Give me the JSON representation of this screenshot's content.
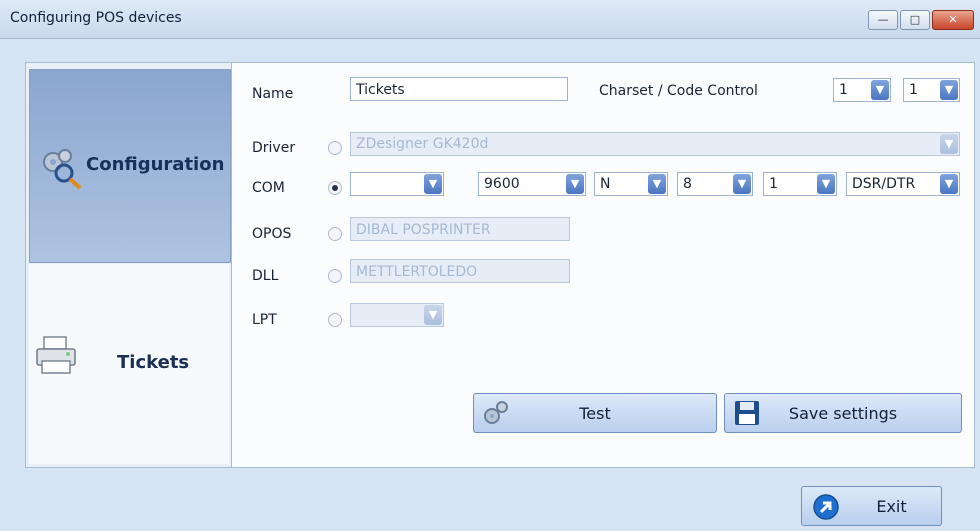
{
  "window": {
    "title": "Configuring POS devices",
    "controls": [
      "minimize",
      "maximize",
      "close"
    ]
  },
  "tabs": [
    {
      "label": "Configuration",
      "icon": "gears-magnifier-icon",
      "selected": true
    },
    {
      "label": "Tickets",
      "icon": "printer-icon",
      "selected": false
    }
  ],
  "form": {
    "name_label": "Name",
    "name_value": "Tickets",
    "charset_label": "Charset / Code Control",
    "charset_value": "1",
    "code_control_value": "1",
    "rows": [
      {
        "label": "Driver",
        "selected": false,
        "value": "ZDesigner GK420d"
      },
      {
        "label": "COM",
        "selected": true,
        "port": "",
        "baud": "9600",
        "parity": "N",
        "databits": "8",
        "stopbits": "1",
        "flow": "DSR/DTR"
      },
      {
        "label": "OPOS",
        "selected": false,
        "value": "DIBAL POSPRINTER"
      },
      {
        "label": "DLL",
        "selected": false,
        "value": "METTLERTOLEDO"
      },
      {
        "label": "LPT",
        "selected": false,
        "value": ""
      }
    ]
  },
  "buttons": {
    "test": "Test",
    "save": "Save settings",
    "exit": "Exit"
  },
  "colors": {
    "accent": "#4b76c1",
    "selected_tab": "#8ba6cf"
  }
}
